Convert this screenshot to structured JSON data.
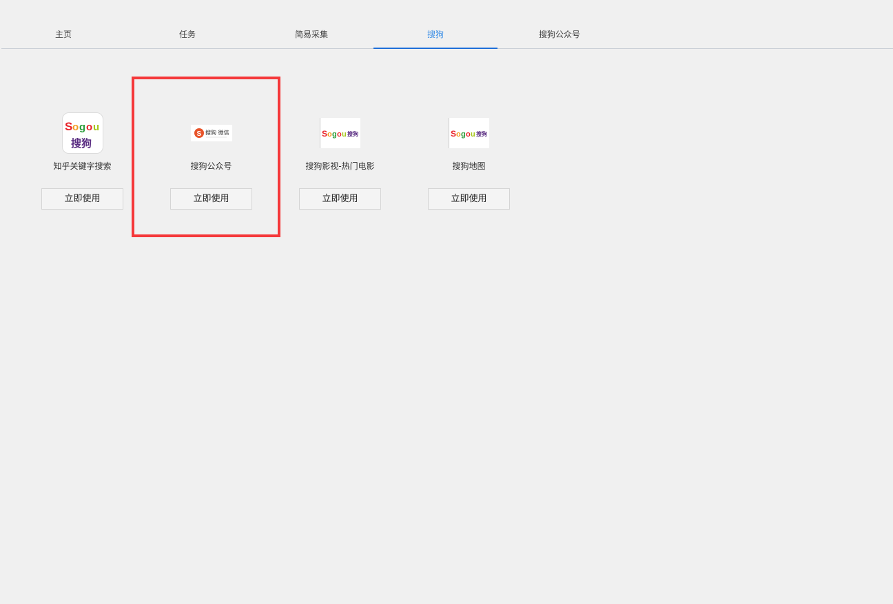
{
  "tabs": [
    {
      "label": "主页"
    },
    {
      "label": "任务"
    },
    {
      "label": "简易采集"
    },
    {
      "label": "搜狗"
    },
    {
      "label": "搜狗公众号"
    }
  ],
  "active_tab": "搜狗",
  "accent_color": "#1e6fd9",
  "highlight_color": "#f5383a",
  "templates": [
    {
      "title": "知乎关键字搜索",
      "button": "立即使用",
      "logo": "sogou-app-icon",
      "logo_text": "Sogou",
      "logo_subtext": "搜狗"
    },
    {
      "title": "搜狗公众号",
      "button": "立即使用",
      "logo": "sogou-weixin-logo",
      "logo_text": "搜狗 微信"
    },
    {
      "title": "搜狗影视-热门电影",
      "button": "立即使用",
      "logo": "sogou-wordmark-logo",
      "logo_text": "Sogou搜狗"
    },
    {
      "title": "搜狗地图",
      "button": "立即使用",
      "logo": "sogou-wordmark-logo",
      "logo_text": "Sogou搜狗"
    }
  ]
}
